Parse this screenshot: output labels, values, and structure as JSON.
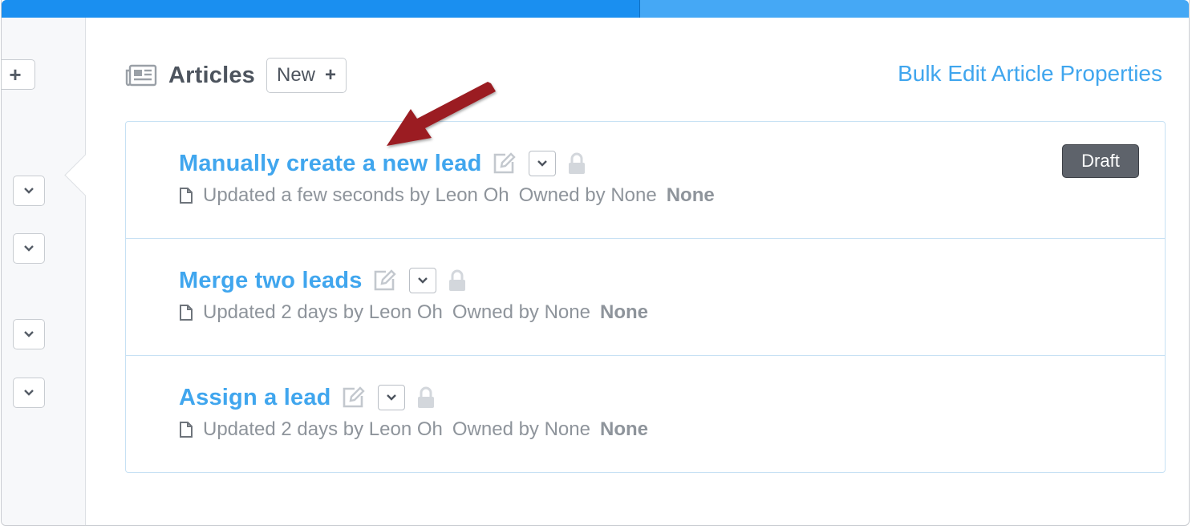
{
  "progress": {
    "value_fraction": 0.537
  },
  "header": {
    "title": "Articles",
    "new_label": "New",
    "new_icon": "plus-icon",
    "bulk_edit_label": "Bulk Edit Article Properties"
  },
  "sidebar": {
    "add_icon": "plus-icon",
    "dropdown_icon": "chevron-down-icon"
  },
  "articles": [
    {
      "title": "Manually create a new lead",
      "updated": "Updated a few seconds by Leon Oh",
      "owned": "Owned by None",
      "status": "None",
      "badge": "Draft"
    },
    {
      "title": "Merge two leads",
      "updated": "Updated 2 days by Leon Oh",
      "owned": "Owned by None",
      "status": "None",
      "badge": ""
    },
    {
      "title": "Assign a lead",
      "updated": "Updated 2 days by Leon Oh",
      "owned": "Owned by None",
      "status": "None",
      "badge": ""
    }
  ],
  "colors": {
    "link": "#40a6ee",
    "progress_fill": "#1a8ff0",
    "progress_track": "#45a8f5",
    "badge_bg": "#5e636b",
    "annotation_arrow": "#9b1f22"
  }
}
